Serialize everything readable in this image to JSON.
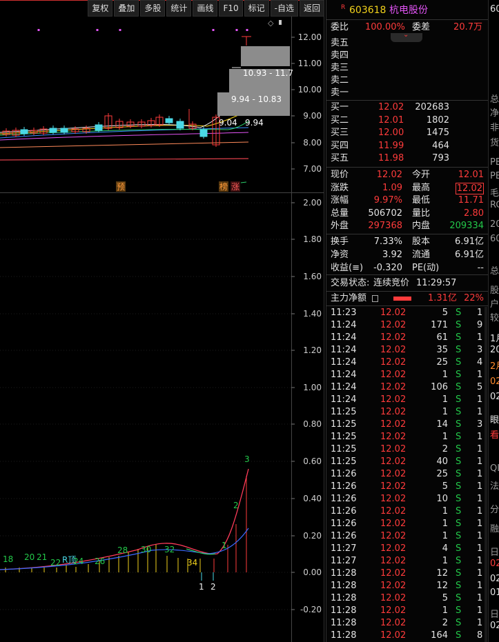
{
  "toolbar": {
    "buttons": [
      "复权",
      "叠加",
      "多股",
      "统计",
      "画线",
      "F10",
      "标记",
      "-自选",
      "返回"
    ]
  },
  "kline": {
    "price_axis": [
      "12.00",
      "11.00",
      "10.00",
      "9.00",
      "8.00",
      "7.00"
    ],
    "zone_labels": [
      "10.93 - 11.7",
      "9.94 - 10.83",
      "9.04",
      "9.94"
    ],
    "markers": [
      "预",
      "榜",
      "涨"
    ]
  },
  "indicator": {
    "axis": [
      "2.00",
      "1.80",
      "1.60",
      "1.40",
      "1.20",
      "1.00",
      "0.80",
      "0.60",
      "0.40",
      "0.20",
      "0.00",
      "-0.20"
    ],
    "labels": [
      "18",
      "20",
      "21",
      "22",
      "R顶",
      "24",
      "26",
      "28",
      "30",
      "32",
      "34",
      "1",
      "2",
      "3",
      "1",
      "2"
    ]
  },
  "header": {
    "badge": "R",
    "code": "603618",
    "name": "杭电股份"
  },
  "weibi": {
    "label1": "委比",
    "value1": "100.00%",
    "label2": "委差",
    "value2": "20.7万"
  },
  "sells": [
    {
      "label": "卖五",
      "price": "",
      "vol": ""
    },
    {
      "label": "卖四",
      "price": "",
      "vol": ""
    },
    {
      "label": "卖三",
      "price": "",
      "vol": ""
    },
    {
      "label": "卖二",
      "price": "",
      "vol": ""
    },
    {
      "label": "卖一",
      "price": "",
      "vol": ""
    }
  ],
  "buys": [
    {
      "label": "买一",
      "price": "12.02",
      "vol": "202683"
    },
    {
      "label": "买二",
      "price": "12.01",
      "vol": "1802"
    },
    {
      "label": "买三",
      "price": "12.00",
      "vol": "1475"
    },
    {
      "label": "买四",
      "price": "11.99",
      "vol": "464"
    },
    {
      "label": "买五",
      "price": "11.98",
      "vol": "793"
    }
  ],
  "quote": [
    {
      "l1": "现价",
      "v1": "12.02",
      "c1": "red",
      "l2": "今开",
      "v2": "12.01",
      "c2": "red"
    },
    {
      "l1": "涨跌",
      "v1": "1.09",
      "c1": "red",
      "l2": "最高",
      "v2": "12.02",
      "c2": "red"
    },
    {
      "l1": "涨幅",
      "v1": "9.97%",
      "c1": "red",
      "l2": "最低",
      "v2": "11.71",
      "c2": "red"
    },
    {
      "l1": "总量",
      "v1": "506702",
      "c1": "white",
      "l2": "量比",
      "v2": "2.80",
      "c2": "red"
    },
    {
      "l1": "外盘",
      "v1": "297368",
      "c1": "red",
      "l2": "内盘",
      "v2": "209334",
      "c2": "green"
    }
  ],
  "fin": [
    {
      "l1": "换手",
      "v1": "7.33%",
      "l2": "股本",
      "v2": "6.91亿"
    },
    {
      "l1": "净资",
      "v1": "3.92",
      "l2": "流通",
      "v2": "6.91亿"
    },
    {
      "l1": "收益(≡)",
      "v1": "-0.320",
      "l2": "PE(动)",
      "v2": "--"
    }
  ],
  "trade_status": {
    "label": "交易状态:",
    "status": "连续竞价",
    "time": "11:29:57"
  },
  "main_flow": {
    "label": "主力净额",
    "value": "1.31亿",
    "pct": "22%"
  },
  "ticks": [
    {
      "t": "11:23",
      "p": "12.02",
      "v": "5",
      "d": "S",
      "n": "1"
    },
    {
      "t": "11:24",
      "p": "12.02",
      "v": "171",
      "d": "S",
      "n": "9"
    },
    {
      "t": "11:24",
      "p": "12.02",
      "v": "61",
      "d": "S",
      "n": "1"
    },
    {
      "t": "11:24",
      "p": "12.02",
      "v": "35",
      "d": "S",
      "n": "3"
    },
    {
      "t": "11:24",
      "p": "12.02",
      "v": "25",
      "d": "S",
      "n": "4"
    },
    {
      "t": "11:24",
      "p": "12.02",
      "v": "1",
      "d": "S",
      "n": "1"
    },
    {
      "t": "11:24",
      "p": "12.02",
      "v": "106",
      "d": "S",
      "n": "5"
    },
    {
      "t": "11:24",
      "p": "12.02",
      "v": "1",
      "d": "S",
      "n": "1"
    },
    {
      "t": "11:25",
      "p": "12.02",
      "v": "1",
      "d": "S",
      "n": "1"
    },
    {
      "t": "11:25",
      "p": "12.02",
      "v": "14",
      "d": "S",
      "n": "3"
    },
    {
      "t": "11:25",
      "p": "12.02",
      "v": "1",
      "d": "S",
      "n": "1"
    },
    {
      "t": "11:25",
      "p": "12.02",
      "v": "2",
      "d": "S",
      "n": "1"
    },
    {
      "t": "11:25",
      "p": "12.02",
      "v": "40",
      "d": "S",
      "n": "1"
    },
    {
      "t": "11:26",
      "p": "12.02",
      "v": "25",
      "d": "S",
      "n": "1"
    },
    {
      "t": "11:26",
      "p": "12.02",
      "v": "5",
      "d": "S",
      "n": "1"
    },
    {
      "t": "11:26",
      "p": "12.02",
      "v": "10",
      "d": "S",
      "n": "1"
    },
    {
      "t": "11:26",
      "p": "12.02",
      "v": "1",
      "d": "S",
      "n": "1"
    },
    {
      "t": "11:26",
      "p": "12.02",
      "v": "1",
      "d": "S",
      "n": "1"
    },
    {
      "t": "11:26",
      "p": "12.02",
      "v": "1",
      "d": "S",
      "n": "1"
    },
    {
      "t": "11:27",
      "p": "12.02",
      "v": "4",
      "d": "S",
      "n": "1"
    },
    {
      "t": "11:27",
      "p": "12.02",
      "v": "1",
      "d": "S",
      "n": "1"
    },
    {
      "t": "11:28",
      "p": "12.02",
      "v": "12",
      "d": "S",
      "n": "1"
    },
    {
      "t": "11:28",
      "p": "12.02",
      "v": "12",
      "d": "S",
      "n": "1"
    },
    {
      "t": "11:28",
      "p": "12.02",
      "v": "5",
      "d": "S",
      "n": "1"
    },
    {
      "t": "11:28",
      "p": "12.02",
      "v": "1",
      "d": "S",
      "n": "1"
    },
    {
      "t": "11:28",
      "p": "12.02",
      "v": "2",
      "d": "S",
      "n": "1"
    },
    {
      "t": "11:28",
      "p": "12.02",
      "v": "164",
      "d": "S",
      "n": "8"
    }
  ],
  "edge": {
    "items": [
      {
        "text": "60",
        "color": "white"
      },
      {
        "text": "总",
        "color": "grey"
      },
      {
        "text": "净",
        "color": "grey"
      },
      {
        "text": "非",
        "color": "grey"
      },
      {
        "text": "货",
        "color": "grey"
      },
      {
        "text": "PE",
        "color": "grey"
      },
      {
        "text": "PE",
        "color": "grey"
      },
      {
        "text": "毛",
        "color": "grey"
      },
      {
        "text": "RC",
        "color": "grey"
      },
      {
        "text": "20",
        "color": "grey"
      },
      {
        "text": "60",
        "color": "grey"
      },
      {
        "text": "总",
        "color": "grey"
      },
      {
        "text": "股",
        "color": "grey"
      },
      {
        "text": "户",
        "color": "grey"
      },
      {
        "text": "较",
        "color": "grey"
      },
      {
        "text": "1月",
        "color": "white"
      },
      {
        "text": "20",
        "color": "white"
      },
      {
        "text": "2月",
        "color": "orange"
      },
      {
        "text": "02",
        "color": "orange"
      },
      {
        "text": "02",
        "color": "white"
      },
      {
        "text": "眼",
        "color": "white"
      },
      {
        "text": "看",
        "color": "red"
      },
      {
        "text": "QI",
        "color": "grey"
      },
      {
        "text": "法",
        "color": "grey"
      },
      {
        "text": "分",
        "color": "grey"
      },
      {
        "text": "融",
        "color": "grey"
      },
      {
        "text": "日",
        "color": "grey"
      },
      {
        "text": "02",
        "color": "red"
      },
      {
        "text": "02",
        "color": "white"
      },
      {
        "text": "01",
        "color": "white"
      },
      {
        "text": "日",
        "color": "grey"
      },
      {
        "text": "02",
        "color": "white"
      }
    ]
  }
}
